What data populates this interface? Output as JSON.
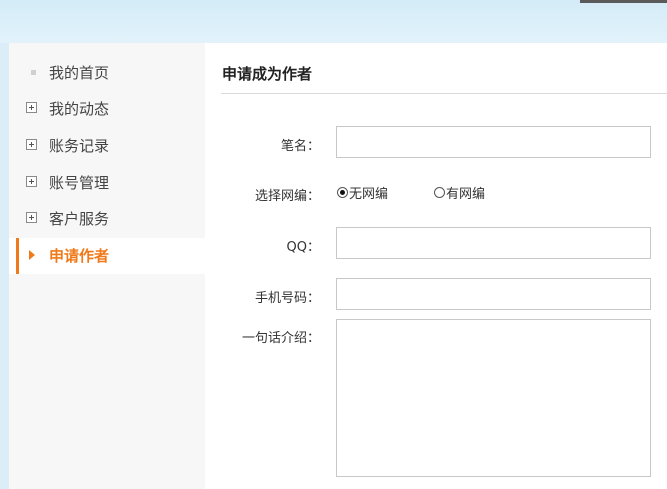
{
  "sidebar": {
    "items": [
      {
        "label": "我的首页",
        "icon": "dot"
      },
      {
        "label": "我的动态",
        "icon": "plus"
      },
      {
        "label": "账务记录",
        "icon": "plus"
      },
      {
        "label": "账号管理",
        "icon": "plus"
      },
      {
        "label": "客户服务",
        "icon": "plus"
      },
      {
        "label": "申请作者",
        "icon": "triangle",
        "active": true
      }
    ]
  },
  "main": {
    "title": "申请成为作者",
    "form": {
      "pen_name_label": "笔名：",
      "pen_name_value": "",
      "editor_label": "选择网编：",
      "editor_options": [
        "无网编",
        "有网编"
      ],
      "editor_selected": "无网编",
      "qq_label": "QQ：",
      "qq_value": "",
      "phone_label": "手机号码：",
      "phone_value": "",
      "intro_label": "一句话介绍：",
      "intro_value": ""
    }
  },
  "colors": {
    "accent": "#f07a1a",
    "sidebar_bg": "#f7f7f7",
    "top_band": "#d4ecf8"
  }
}
